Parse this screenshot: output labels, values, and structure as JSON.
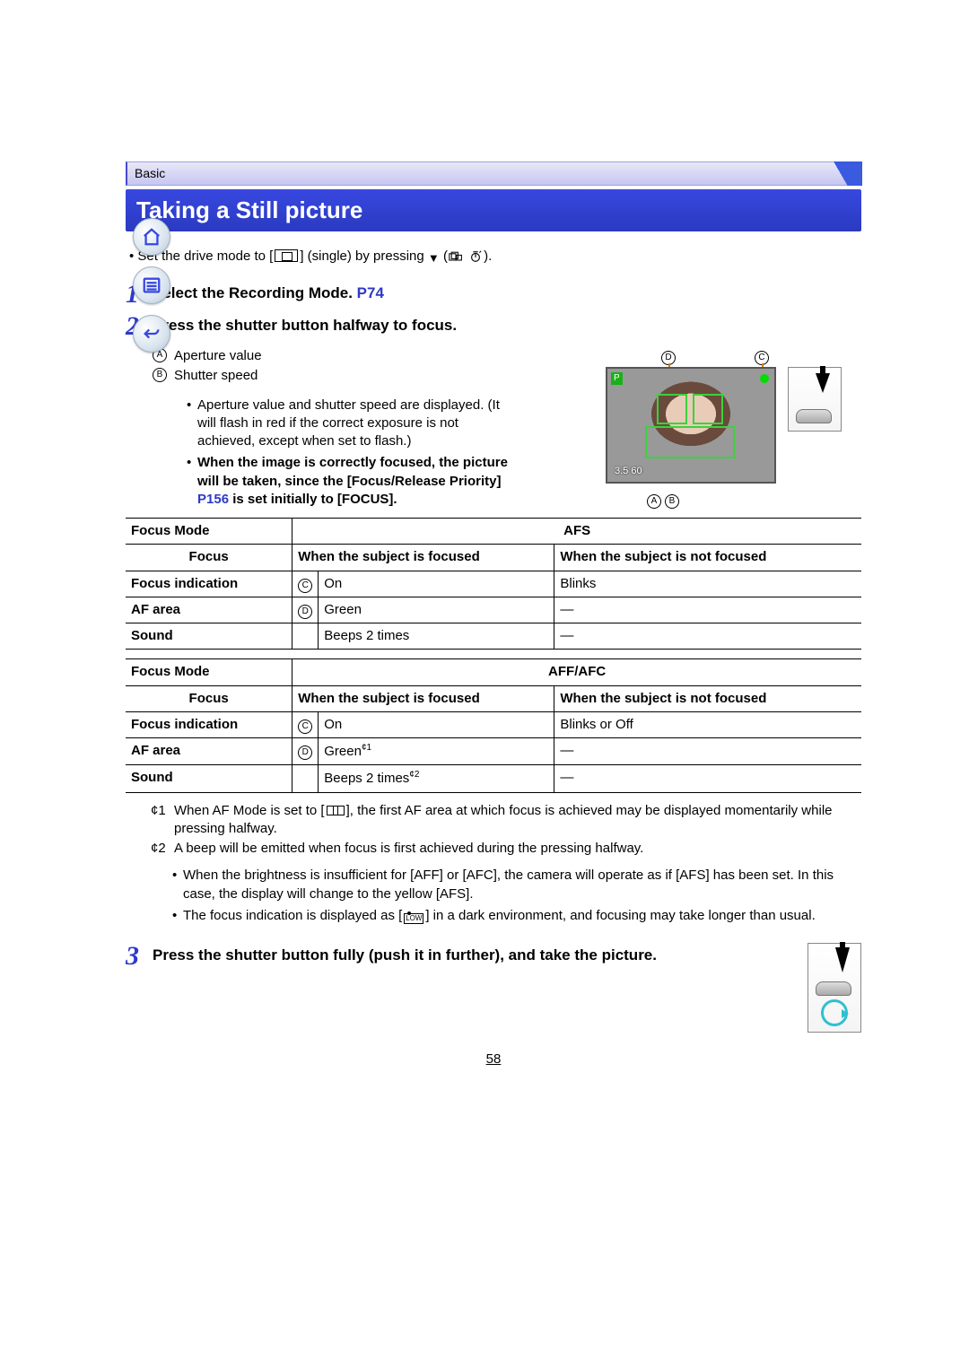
{
  "category": "Basic",
  "title": "Taking a Still picture",
  "pre_step": {
    "pre": "Set the drive mode to [",
    "mid": "] (single) by pressing ",
    "post1": " (",
    "post2": ")."
  },
  "steps": [
    {
      "num": "1",
      "title_pre": "Select the Recording Mode. ",
      "title_ref": "P74"
    },
    {
      "num": "2",
      "title_pre": "Press the shutter button halfway to focus."
    },
    {
      "num": "3",
      "title_pre": "Press the shutter button fully (push it in further), and take the picture."
    }
  ],
  "legendA": "Aperture value",
  "legendB": "Shutter speed",
  "lcd": {
    "mode": "P",
    "aperture": "3.5",
    "shutter": "60"
  },
  "halfwayNotes": [
    {
      "plain": "Aperture value and shutter speed are displayed. (It will flash in red if the correct exposure is not achieved, except when set to flash.)"
    },
    {
      "bold_pre": "When the image is correctly focused, the picture will be taken, since the [Focus/Release Priority] ",
      "ref": "P156",
      "bold_post": " is set initially to [FOCUS]."
    }
  ],
  "table1": {
    "h_mode": "Focus Mode",
    "mode": "AFS",
    "h_focus": "Focus",
    "col2": "When the subject is focused",
    "col3": "When the subject is not focused",
    "r1c1": "Focus indication",
    "r1i": "C",
    "r1c2": "On",
    "r1c3": "Blinks",
    "r2c1": "AF area",
    "r2i": "D",
    "r2c2": "Green",
    "r2c3": "—",
    "r3c1": "Sound",
    "r3c2": "Beeps 2 times",
    "r3c3": "—"
  },
  "table2": {
    "h_mode": "Focus Mode",
    "mode": "AFF/AFC",
    "h_focus": "Focus",
    "col2": "When the subject is focused",
    "col3": "When the subject is not focused",
    "r1c1": "Focus indication",
    "r1i": "C",
    "r1c2": "On",
    "r1c3": "Blinks or Off",
    "r2c1": "AF area",
    "r2i": "D",
    "r2c2_pre": "Green",
    "r2c2_sup": "¢1",
    "r2c3": "—",
    "r3c1": "Sound",
    "r3c2_pre": "Beeps 2 times",
    "r3c2_sup": "¢2",
    "r3c3": "—"
  },
  "starNotes": [
    {
      "p": "¢1",
      "pre": "When AF Mode is set to [",
      "post": "], the first AF area at which focus is achieved may be displayed momentarily while pressing halfway."
    },
    {
      "p": "¢2",
      "text": "A beep will be emitted when focus is first achieved during the pressing halfway."
    }
  ],
  "generalBullets": [
    "When the brightness is insufficient for [AFF] or [AFC], the camera will operate as if [AFS] has been set. In this case, the display will change to the yellow [AFS].",
    "__focus_low__"
  ],
  "focusLow_pre": "The focus indication is displayed as [",
  "focusLow_post": "] in a dark environment, and focusing may take longer than usual.",
  "pageNumber": "58"
}
